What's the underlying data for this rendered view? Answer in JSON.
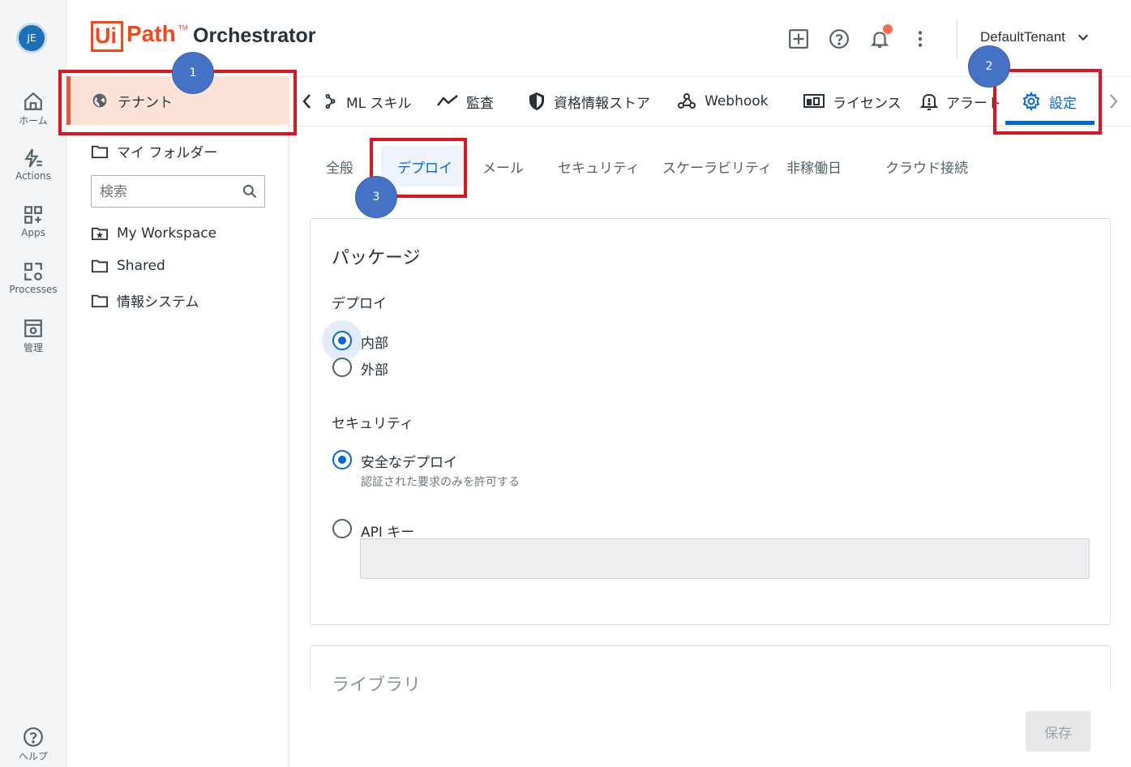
{
  "rail": {
    "avatar_initials": "JE",
    "items": [
      {
        "label": "ホーム",
        "icon": "home-icon"
      },
      {
        "label": "Actions",
        "icon": "actions-icon"
      },
      {
        "label": "Apps",
        "icon": "apps-icon"
      },
      {
        "label": "Processes",
        "icon": "processes-icon"
      },
      {
        "label": "管理",
        "icon": "admin-icon"
      }
    ],
    "help_label": "ヘルプ"
  },
  "header": {
    "logo_ui": "Ui",
    "logo_path": "Path",
    "logo_tm": "TM",
    "product_name": "Orchestrator",
    "tenant_name": "DefaultTenant",
    "notification_color": "#fa6a50"
  },
  "folders": {
    "tenant_label": "テナント",
    "my_folders_label": "マイ フォルダー",
    "search_placeholder": "検索",
    "items": [
      "My Workspace",
      "Shared",
      "情報システム"
    ]
  },
  "top_tabs": [
    {
      "label": "ML スキル",
      "icon": "ml-skill-icon"
    },
    {
      "label": "監査",
      "icon": "audit-icon"
    },
    {
      "label": "資格情報ストア",
      "icon": "shield-icon"
    },
    {
      "label": "Webhook",
      "icon": "webhook-icon"
    },
    {
      "label": "ライセンス",
      "icon": "license-icon"
    },
    {
      "label": "アラート",
      "icon": "alert-icon"
    },
    {
      "label": "設定",
      "icon": "gear-icon",
      "active": true
    }
  ],
  "sub_tabs": [
    "全般",
    "デプロイ",
    "メール",
    "セキュリティ",
    "スケーラビリティ",
    "非稼働日",
    "クラウド接続"
  ],
  "sub_tabs_active": "デプロイ",
  "package_card": {
    "title": "パッケージ",
    "deploy_label": "デプロイ",
    "deploy_options": [
      "内部",
      "外部"
    ],
    "deploy_selected": "内部",
    "security_label": "セキュリティ",
    "secure_deploy_label": "安全なデプロイ",
    "secure_deploy_sub": "認証された要求のみを許可する",
    "api_key_label": "API キー",
    "api_key_value": ""
  },
  "library_card": {
    "title": "ライブラリ"
  },
  "save_label": "保存",
  "annotations": {
    "badge_1": "1",
    "badge_2": "2",
    "badge_3": "3",
    "box_color": "#e0141e",
    "badge_color": "#4472c4"
  },
  "accent_color": "#0067df"
}
